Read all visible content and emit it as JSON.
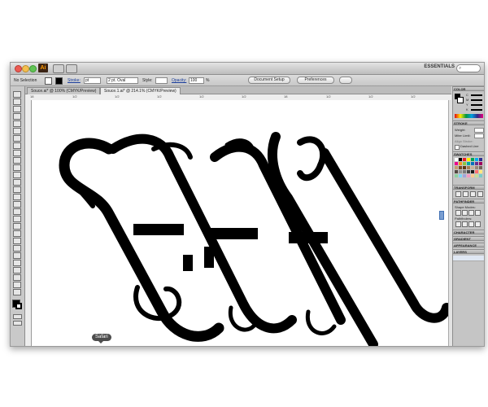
{
  "app": {
    "logo": "Ai",
    "workspace": "ESSENTIALS",
    "search_placeholder": ""
  },
  "control_bar": {
    "selection_label": "No Selection",
    "stroke_label": "Stroke:",
    "stroke_value": "pt",
    "brush_value": "2 pt. Oval",
    "style_label": "Style:",
    "opacity_label": "Opacity:",
    "opacity_value": "100",
    "opacity_unit": "%",
    "document_setup": "Document Setup",
    "preferences": "Preferences"
  },
  "tabs": [
    {
      "label": "Souce.ai* @ 100% (CMYK/Preview)"
    },
    {
      "label": "Souce.1.ai* @ 214.1% (CMYK/Preview)"
    }
  ],
  "ruler_labels": [
    "18",
    "1/2",
    "1/2",
    "1/2",
    "1/2",
    "1/2",
    "18",
    "1/2",
    "1/2",
    "1/2"
  ],
  "panels": {
    "color": "COLOR",
    "color_channels": [
      "C",
      "M",
      "Y",
      "K"
    ],
    "stroke": "STROKE",
    "weight_label": "Weight:",
    "miter_label": "Miter Limit:",
    "align_label": "Align Stroke:",
    "dashed_label": "Dashed Line",
    "swatches": "SWATCHES",
    "transform": "TRANSFORM",
    "align": "ALIGN",
    "pathfinder": "PATHFINDER",
    "shape_modes": "Shape Modes:",
    "pathfinders": "Pathfinders:",
    "character": "CHARACTER",
    "gradient": "GRADIENT",
    "transparency": "TRANSPAREN",
    "appearance": "APPEARANCE",
    "graphic_styles": "GRAPHIC",
    "layers": "LAYERS"
  },
  "swatch_colors": [
    "#ffffff",
    "#000000",
    "#ed1c24",
    "#fff200",
    "#00a651",
    "#00aeef",
    "#2e3192",
    "#ec008c",
    "#f7941d",
    "#8dc63f",
    "#00a99d",
    "#0072bc",
    "#662d91",
    "#9e005d",
    "#c69c6d",
    "#754c24",
    "#603913",
    "#a67c52",
    "#c7b299",
    "#998675",
    "#736357",
    "#534741",
    "#959595",
    "#7b7b7b",
    "#464646",
    "#1a1a1a",
    "#ff6f6f",
    "#ffe97f",
    "#8ed3a0",
    "#7fd6f7",
    "#a3a6d9",
    "#f49ac1",
    "#fbc98f",
    "#c4df9b",
    "#7accc8"
  ],
  "tooltip": "Safari"
}
